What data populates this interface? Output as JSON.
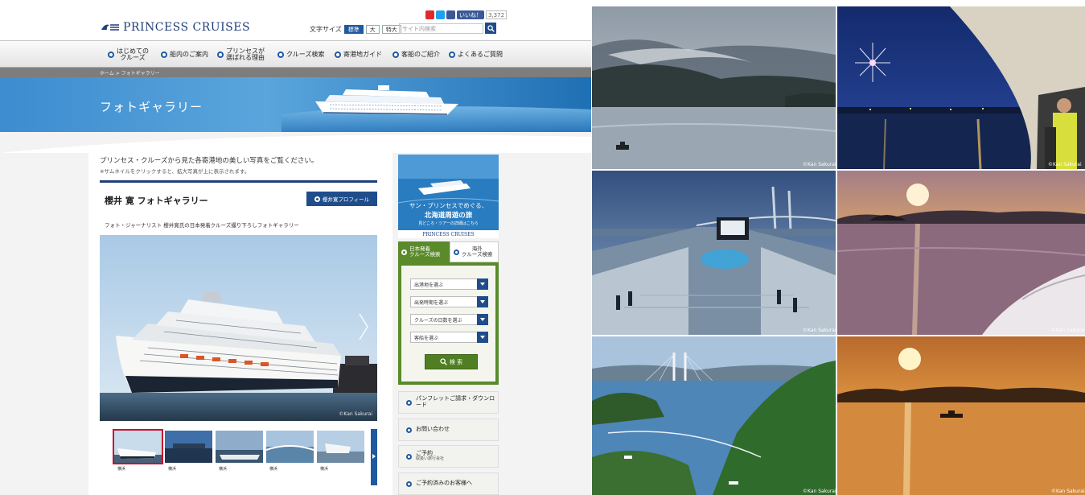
{
  "header": {
    "logo_text": "PRINCESS CRUISES",
    "font_size_label": "文字サイズ",
    "font_sizes": [
      "標準",
      "大",
      "特大"
    ],
    "search_placeholder": "サイト内検索",
    "like_label": "いいね！",
    "like_count": "3,372"
  },
  "nav": {
    "items": [
      {
        "line1": "はじめての",
        "line2": "クルーズ"
      },
      {
        "line1": "船内のご案内",
        "line2": ""
      },
      {
        "line1": "プリンセスが",
        "line2": "選ばれる理由"
      },
      {
        "line1": "クルーズ検索",
        "line2": ""
      },
      {
        "line1": "寄港地ガイド",
        "line2": ""
      },
      {
        "line1": "客船のご紹介",
        "line2": ""
      },
      {
        "line1": "よくあるご質問",
        "line2": ""
      }
    ]
  },
  "breadcrumb": "ホーム > フォトギャラリー",
  "banner": {
    "title": "フォトギャラリー"
  },
  "main": {
    "intro": "プリンセス・クルーズから見た各寄港地の美しい写真をご覧ください。",
    "intro_note": "※サムネイルをクリックすると、拡大写真が上に表示されます。",
    "gallery_title": "櫻井 寛 フォトギャラリー",
    "profile_button": "櫻井寛プロフィール",
    "gallery_desc": "フォト・ジャーナリスト 櫻井寛氏の日本発着クルーズ撮り下ろしフォトギャラリー",
    "photo_credit": "©Kan Sakurai",
    "thumb_captions": [
      "横浜",
      "横浜",
      "横浜",
      "横浜",
      "横浜"
    ]
  },
  "sidebar": {
    "ad_line1": "サン・プリンセスでめぐる、",
    "ad_line2": "北海道周遊の旅",
    "ad_line3": "見どころ・ツアーの詳細はこちら",
    "ad_logo": "PRINCESS CRUISES",
    "tab_japan_1": "日本発着",
    "tab_japan_2": "クルーズ検索",
    "tab_overseas_1": "海外",
    "tab_overseas_2": "クルーズ検索",
    "selects": [
      "出港地を選ぶ",
      "出発時期を選ぶ",
      "クルーズの日数を選ぶ",
      "客船を選ぶ"
    ],
    "search_button": "検 索",
    "links": [
      {
        "label": "パンフレットご請求・ダウンロード",
        "sub": ""
      },
      {
        "label": "お問い合わせ",
        "sub": ""
      },
      {
        "label": "ご予約",
        "sub": "取扱い旅行会社"
      },
      {
        "label": "ご予約済みのお客様へ",
        "sub": ""
      }
    ]
  },
  "grid": {
    "credit": "©Kan Sakurai"
  },
  "colors": {
    "brand_blue": "#1f4d8c",
    "search_green": "#5a8a2a",
    "banner_blue": "#3d8ccf"
  }
}
